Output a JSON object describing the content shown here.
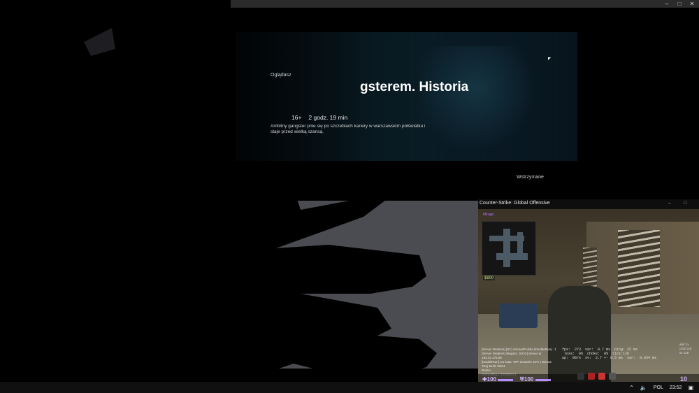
{
  "netflix": {
    "watching_label": "Oglądasz",
    "title": "gsterem. Historia",
    "age_rating": "16+",
    "duration": "2 godz. 19 min",
    "description": "Ambitny gangster pnie się po szczeblach kariery w warszawskim półświatku i staje przed wielką szansą.",
    "status": "Wstrzymane"
  },
  "csgo": {
    "window_title": "Counter-Strike: Global Offensive",
    "radar_label": "Mirage",
    "money": "$800",
    "health": "100",
    "armor": "100",
    "ammo": "10",
    "netgraph": "fps:  273  var:  0.7 ms  ping: 25 ms\n loss:  0%  choke:  0%  tick:128\nup:  80/s  sv:  2.7 +- 0.5 ms  var:  0.034 ms",
    "chat": [
      "[Server Redirect] [SC] eXceedPolska (DoubleRun) : 1",
      "[Server Redirect] Wagasz: [SCG] Server ip: 193.33.176.89",
      "[DoubleRun] Ca ssqs: VIP! dostanie 10% z Bonus: Twoj Multi: Wkn1",
      "RUSH",
      "Defrauding  1  SCREEN  1"
    ],
    "side_text": [
      "amf 1x",
      "cmd 128",
      "sv 128"
    ]
  },
  "taskbar": {
    "language": "POL",
    "time": "23:52"
  },
  "colors": {
    "hud_purple": "#b58cff",
    "taskbar": "#101010",
    "title_bar": "#2b2b2b"
  }
}
